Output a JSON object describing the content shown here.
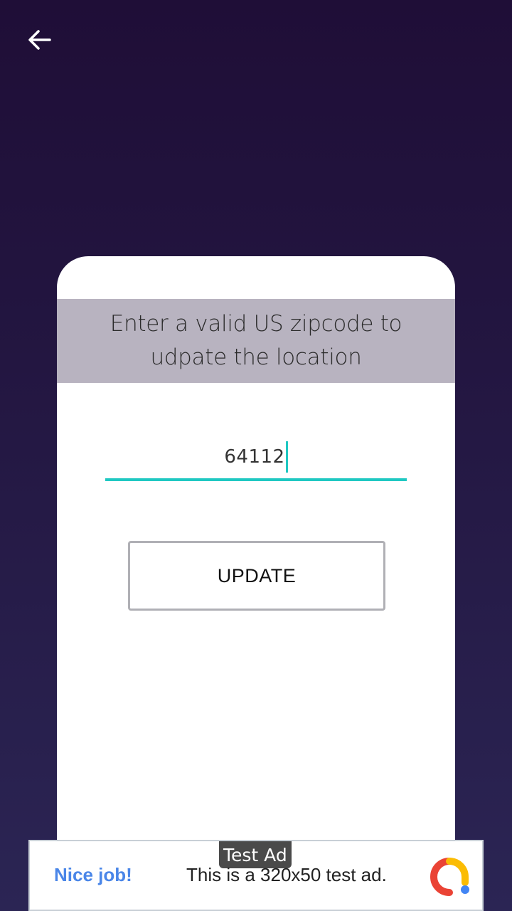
{
  "nav": {
    "back_icon": "arrow-left-icon"
  },
  "card": {
    "header_text": "Enter a valid US zipcode to udpate the location",
    "zip_value": "64112",
    "update_label": "UPDATE"
  },
  "ad": {
    "tag": "Test Ad",
    "headline": "Nice job!",
    "body": "This is a 320x50 test ad.",
    "logo_icon": "admob-logo-icon"
  },
  "colors": {
    "accent": "#1fc8c2",
    "header_bg": "#b8b3c0",
    "ad_link": "#4a86e8"
  }
}
